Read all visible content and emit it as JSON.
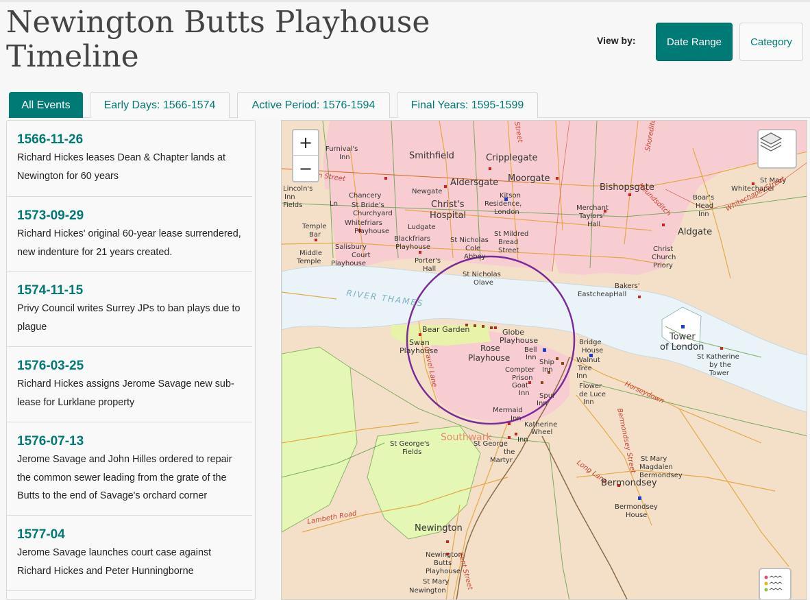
{
  "page": {
    "title": "Newington Butts Playhouse Timeline",
    "view_by_label": "View by:",
    "view_buttons": [
      {
        "label": "Date Range",
        "active": true
      },
      {
        "label": "Category",
        "active": false
      }
    ]
  },
  "tabs": [
    {
      "label": "All Events",
      "active": true
    },
    {
      "label": "Early Days: 1566-1574",
      "active": false
    },
    {
      "label": "Active Period: 1576-1594",
      "active": false
    },
    {
      "label": "Final Years: 1595-1599",
      "active": false
    }
  ],
  "events": [
    {
      "date": "1566-11-26",
      "description": "Richard Hickes leases Dean & Chapter lands at Newington for 60 years"
    },
    {
      "date": "1573-09-29",
      "description": "Richard Hickes' original 60-year lease surrendered, new indenture for 21 years created."
    },
    {
      "date": "1574-11-15",
      "description": "Privy Council writes Surrey JPs to ban plays due to plague"
    },
    {
      "date": "1576-03-25",
      "description": "Richard Hickes assigns Jerome Savage new sub-lease for Lurklane property"
    },
    {
      "date": "1576-07-13",
      "description": "Jerome Savage and John Hilles ordered to repair the common sewer leading from the grate of the Butts to the end of Savage's orchard corner"
    },
    {
      "date": "1577-04",
      "description": "Jerome Savage launches court case against Richard Hickes and Peter Hunningborne"
    }
  ],
  "map": {
    "zoom_in": "+",
    "zoom_out": "−",
    "layers_icon": "layers-icon",
    "legend_icon": "legend-icon",
    "colors": {
      "teal": "#007a75",
      "city": "#f8cdd2",
      "land": "#f4e0c8",
      "river": "#e9f3f8",
      "fields": "#e4f7b4",
      "circle": "#7a2a9a"
    },
    "labels": {
      "smithfield": "Smithfield",
      "cripplegate": "Cripplegate",
      "aldersgate": "Aldersgate",
      "moorgate": "Moorgate",
      "bishopsgate": "Bishopsgate",
      "furnivals": "Furnival's",
      "inn": "Inn",
      "holborn": "Holborn Street",
      "lincolns": "Lincoln's",
      "lincolns_inn": "Inn",
      "lincolns_fields": "Fields",
      "chancery": "Chancery",
      "chancery_ln": "Ln",
      "newgate": "Newgate",
      "christs": "Christ's",
      "hospital": "Hospital",
      "kitson": "Kitson",
      "kitson_res": "Residence,",
      "kitson_london": "London",
      "stbrides": "St Bride's",
      "churchyard": "Churchyard",
      "whitefriars": "Whitefriars",
      "playhouse_wf": "Playhouse",
      "ludgate": "Ludgate",
      "merchant": "Merchant",
      "taylors": "Taylors'",
      "hall": "Hall",
      "aldgate": "Aldgate",
      "boars": "Boar's",
      "head": "Head",
      "boars_inn": "Inn",
      "stmary_wc": "St Mary",
      "whitechapel": "Whitechapel",
      "whitechapel_st": "Whitechapel Street",
      "houndsditch": "Houndsditch",
      "shoreditch": "Shoreditch",
      "street_top": "Street",
      "temple": "Temple",
      "bar": "Bar",
      "middle": "Middle",
      "temple2": "Temple",
      "salisbury": "Salisbury",
      "court": "Court",
      "playhouse_sb": "Playhouse",
      "blackfriars": "Blackfriars",
      "playhouse_bf": "Playhouse",
      "porters": "Porter's",
      "porters_hall": "Hall",
      "stnicholas": "St Nicholas",
      "cole": "Cole",
      "abbey": "Abbey",
      "stmildred": "St Mildred",
      "bread": "Bread",
      "street": "Street",
      "christ_church": "Christ",
      "church": "Church",
      "priory": "Priory",
      "stnicholas_olave": "St Nicholas",
      "olave": "Olave",
      "bakers": "Bakers'",
      "eastcheap": "EastcheapHall",
      "river": "RIVER THAMES",
      "bear": "Bear Garden",
      "swan": "Swan",
      "swan_ph": "Playhouse",
      "globe": "Globe",
      "globe_ph": "Playhouse",
      "rose": "Rose",
      "rose_ph": "Playhouse",
      "bell": "Bell",
      "bell_inn": "Inn",
      "ship": "Ship",
      "ship_inn": "Inn",
      "bridge": "Bridge",
      "bridge_house": "House",
      "walnut": "Walnut",
      "tree": "Tree",
      "tree_inn": "Inn",
      "compter": "Compter",
      "prison": "Prison",
      "goat": "Goat",
      "goat_inn": "Inn",
      "spur": "Spur",
      "spur_inn": "Inn",
      "flower": "Flower",
      "deluce": "de Luce",
      "deluce_inn": "Inn",
      "tower": "Tower",
      "oflondon": "of London",
      "stkath": "St Katherine",
      "bythe": "by the",
      "tower2": "Tower",
      "horseydown": "Horseydown",
      "mermaid": "Mermaid",
      "mermaid_inn": "Inn",
      "katherine": "Katherine",
      "wheel": "Wheel",
      "wheel_inn": "Inn",
      "southwark": "Southwark",
      "gravel": "Gravel Lane",
      "stgeorges": "St George's",
      "fields": "Fields",
      "stgeorge": "St George",
      "the": "the",
      "martyr": "Martyr",
      "bermondsey_st": "Bermondsey Street",
      "longlane": "Long Lane",
      "stmary_mb": "St Mary",
      "magdalen": "Magdalen",
      "bermondsey_mb": "Bermondsey",
      "bermondsey": "Bermondsey",
      "bermondsey_h": "Bermondsey",
      "house": "House",
      "lambeth": "Lambeth Road",
      "newington": "Newington",
      "newington2": "Newington",
      "butts": "Butts",
      "playhouse_nb": "Playhouse",
      "stmary_n": "St Mary",
      "newington3": "Newington",
      "lane_s": "Kent Street"
    }
  }
}
